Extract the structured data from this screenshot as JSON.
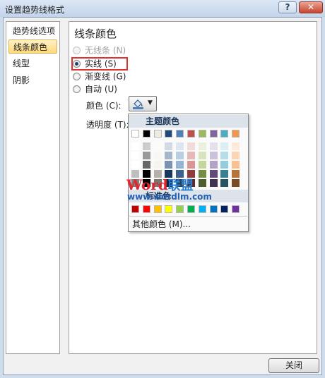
{
  "window": {
    "title": "设置趋势线格式",
    "help": "?",
    "close_glyph": "✕"
  },
  "nav": {
    "items": [
      {
        "label": "趋势线选项"
      },
      {
        "label": "线条颜色"
      },
      {
        "label": "线型"
      },
      {
        "label": "阴影"
      }
    ]
  },
  "panel": {
    "title": "线条颜色",
    "options": [
      {
        "label": "无线条 (N)",
        "state": "disabled"
      },
      {
        "label": "实线 (S)",
        "state": "checked"
      },
      {
        "label": "渐变线 (G)",
        "state": "unchecked"
      },
      {
        "label": "自动 (U)",
        "state": "unchecked"
      }
    ],
    "color_label": "颜色 (C):",
    "transparency_label": "透明度 (T):"
  },
  "popup": {
    "theme_header": "主题颜色",
    "standard_header": "标准色",
    "more_colors": "其他颜色 (M)...",
    "theme_colors": [
      "#ffffff",
      "#000000",
      "#eeece1",
      "#1f497d",
      "#4f81bd",
      "#c0504d",
      "#9bbb59",
      "#8064a2",
      "#4bacc6",
      "#f79646"
    ],
    "standard_colors": [
      "#c00000",
      "#ff0000",
      "#ffc000",
      "#ffff00",
      "#92d050",
      "#00b050",
      "#00b0f0",
      "#0070c0",
      "#002060",
      "#7030a0"
    ]
  },
  "watermark": {
    "word": "Word",
    "cn": "联盟",
    "url": "www.wordlm.com"
  },
  "footer": {
    "close_label": "关闭"
  },
  "colors": {
    "accent": "#1f3f78",
    "highlight": "#e23030"
  }
}
